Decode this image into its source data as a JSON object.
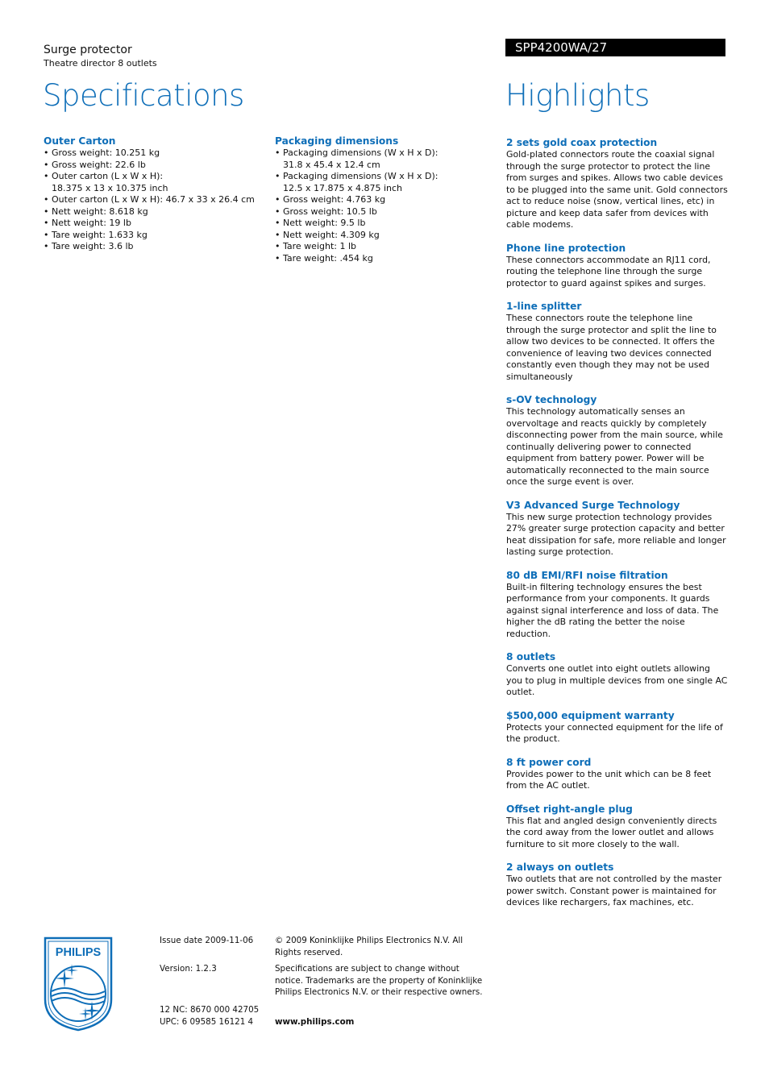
{
  "header": {
    "product_name": "Surge protector",
    "product_subtitle": "Theatre director 8 outlets",
    "model_number": "SPP4200WA/27",
    "specifications_title": "Specifications",
    "highlights_title": "Highlights"
  },
  "specifications": {
    "outer_carton": {
      "title": "Outer Carton",
      "items": [
        "Gross weight: 10.251 kg",
        "Gross weight: 22.6 lb",
        "Outer carton (L x W x H): 18.375 x 13 x 10.375 inch",
        "Outer carton (L x W x H): 46.7 x 33 x 26.4 cm",
        "Nett weight: 8.618 kg",
        "Nett weight: 19 lb",
        "Tare weight: 1.633 kg",
        "Tare weight: 3.6 lb"
      ]
    },
    "packaging_dimensions": {
      "title": "Packaging dimensions",
      "items": [
        "Packaging dimensions (W x H x D): 31.8 x 45.4 x 12.4 cm",
        "Packaging dimensions (W x H x D): 12.5 x 17.875 x 4.875 inch",
        "Gross weight: 4.763 kg",
        "Gross weight: 10.5 lb",
        "Nett weight: 9.5 lb",
        "Nett weight: 4.309 kg",
        "Tare weight: 1 lb",
        "Tare weight: .454 kg"
      ]
    }
  },
  "highlights": [
    {
      "title": "2 sets gold coax protection",
      "text": "Gold-plated connectors route the coaxial signal through the surge protector to protect the line from surges and spikes. Allows two cable devices to be plugged into the same unit. Gold connectors act to reduce noise (snow, vertical lines, etc) in picture and keep data safer from devices with cable modems."
    },
    {
      "title": "Phone line protection",
      "text": "These connectors accommodate an RJ11 cord, routing the telephone line through the surge protector to guard against spikes and surges."
    },
    {
      "title": "1-line splitter",
      "text": "These connectors route the telephone line through the surge protector and split the line to allow two devices to be connected. It offers the convenience of leaving two devices connected constantly even though they may not be used simultaneously"
    },
    {
      "title": "s-OV technology",
      "text": "This technology automatically senses an overvoltage and reacts quickly by completely disconnecting power from the main source, while continually delivering power to connected equipment from battery power. Power will be automatically reconnected to the main source once the surge event is over."
    },
    {
      "title": "V3 Advanced Surge Technology",
      "text": "This new surge protection technology provides 27% greater surge protection capacity and better heat dissipation for safe, more reliable and longer lasting surge protection."
    },
    {
      "title": "80 dB EMI/RFI noise filtration",
      "text": "Built-in filtering technology ensures the best performance from your components. It guards against signal interference and loss of data. The higher the dB rating the better the noise reduction."
    },
    {
      "title": "8 outlets",
      "text": "Converts one outlet into eight outlets allowing you to plug in multiple devices from one single AC outlet."
    },
    {
      "title": "$500,000 equipment warranty",
      "text": "Protects your connected equipment for the life of the product."
    },
    {
      "title": "8 ft power cord",
      "text": "Provides power to the unit which can be 8 feet from the AC outlet."
    },
    {
      "title": "Offset right-angle plug",
      "text": "This flat and angled design conveniently directs the cord away from the lower outlet and allows furniture to sit more closely to the wall."
    },
    {
      "title": "2 always on outlets",
      "text": "Two outlets that are not controlled by the master power switch. Constant power is maintained for devices like rechargers, fax machines, etc."
    }
  ],
  "footer": {
    "logo_text": "PHILIPS",
    "issue_date": "Issue date 2009-11-06",
    "version": "Version: 1.2.3",
    "nc": "12 NC: 8670 000 42705",
    "upc": "UPC: 6 09585 16121 4",
    "copyright": "© 2009 Koninklijke Philips Electronics N.V. All Rights reserved.",
    "disclaimer": "Specifications are subject to change without notice. Trademarks are the property of Koninklijke Philips Electronics N.V. or their respective owners.",
    "website": "www.philips.com"
  },
  "colors": {
    "accent_blue": "#0e6eb8",
    "model_bar_bg": "#000000"
  }
}
